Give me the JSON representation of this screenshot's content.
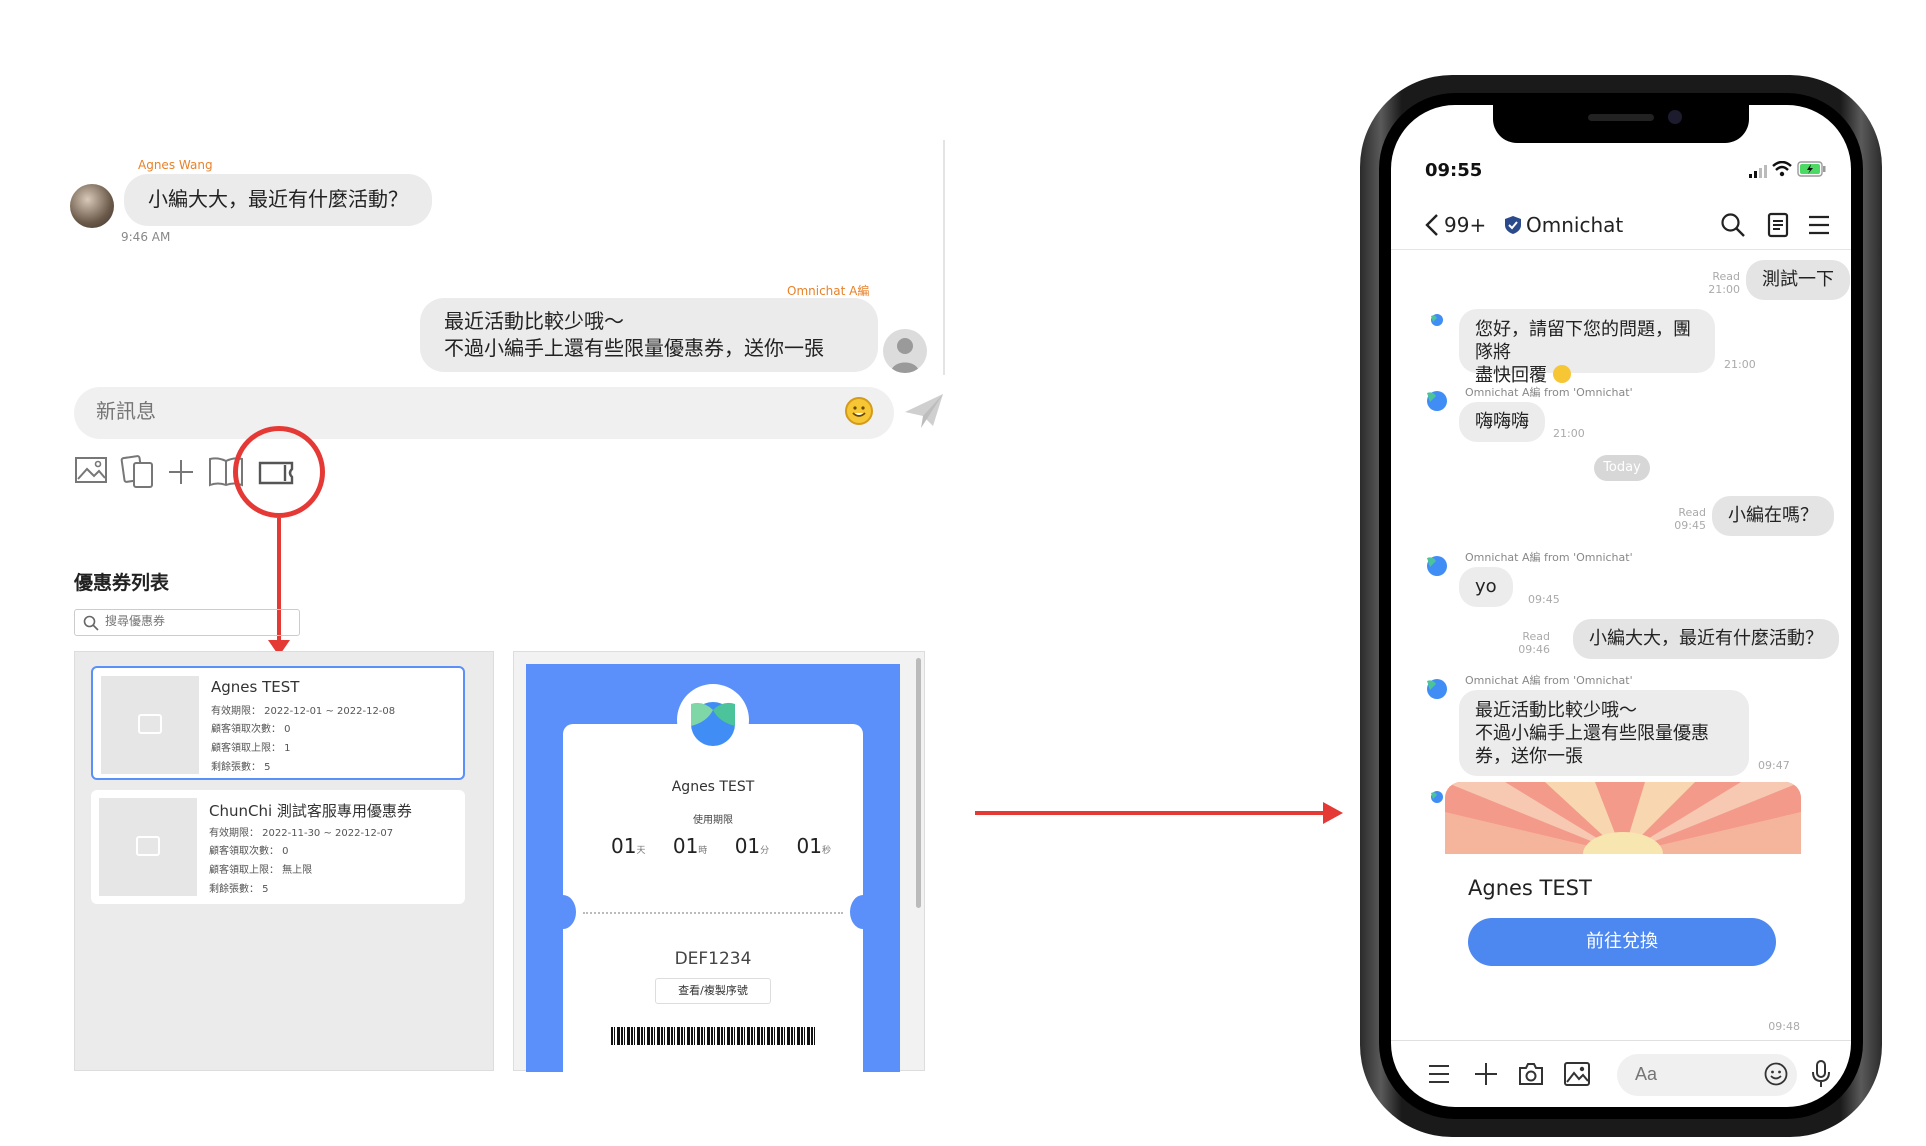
{
  "desktop_chat": {
    "incoming": {
      "sender": "Agnes Wang",
      "text": "小編大大，最近有什麼活動？",
      "time": "9:46 AM"
    },
    "outgoing": {
      "sender": "Omnichat A編",
      "line1": "最近活動比較少哦～",
      "line2": "不過小編手上還有些限量優惠券，送你一張"
    },
    "input_placeholder": "新訊息"
  },
  "coupon_panel": {
    "title": "優惠券列表",
    "search_placeholder": "搜尋優惠券",
    "coupons": [
      {
        "name": "Agnes TEST",
        "validity": "有效期限： 2022-12-01 ~ 2022-12-08",
        "claimed": "顧客領取次數： 0",
        "limit": "顧客領取上限： 1",
        "remaining": "剩餘張數： 5"
      },
      {
        "name": "ChunChi 測試客服專用優惠券",
        "validity": "有效期限： 2022-11-30 ~ 2022-12-07",
        "claimed": "顧客領取次數： 0",
        "limit": "顧客領取上限： 無上限",
        "remaining": "剩餘張數： 5"
      }
    ],
    "preview": {
      "name": "Agnes TEST",
      "period_label": "使用期限",
      "countdown": [
        {
          "value": "01",
          "unit": "天"
        },
        {
          "value": "01",
          "unit": "時"
        },
        {
          "value": "01",
          "unit": "分"
        },
        {
          "value": "01",
          "unit": "秒"
        }
      ],
      "code": "DEF1234",
      "copy_button": "查看/複製序號"
    }
  },
  "phone": {
    "status_time": "09:55",
    "header": {
      "back_count": "99+",
      "title": "Omnichat"
    },
    "messages": {
      "m1": {
        "text": "測試一下",
        "read": "Read",
        "time": "21:00"
      },
      "m2": {
        "line1": "您好，請留下您的問題，團隊將",
        "line2": "盡快回覆",
        "time": "21:00"
      },
      "m3": {
        "bot": "Omnichat A編 from 'Omnichat'",
        "text": "嗨嗨嗨",
        "time": "21:00"
      },
      "today": "Today",
      "m4": {
        "text": "小編在嗎？",
        "read": "Read",
        "time": "09:45"
      },
      "m5": {
        "bot": "Omnichat A編 from 'Omnichat'",
        "text": "yo",
        "time": "09:45"
      },
      "m6": {
        "text": "小編大大，最近有什麼活動？",
        "read": "Read",
        "time": "09:46"
      },
      "m7": {
        "bot": "Omnichat A編 from 'Omnichat'",
        "line1": "最近活動比較少哦～",
        "line2": "不過小編手上還有些限量優惠",
        "line3": "券，送你一張",
        "time": "09:47"
      },
      "card": {
        "title": "Agnes TEST",
        "button": "前往兌換",
        "time": "09:48"
      }
    },
    "input_placeholder": "Aa"
  }
}
